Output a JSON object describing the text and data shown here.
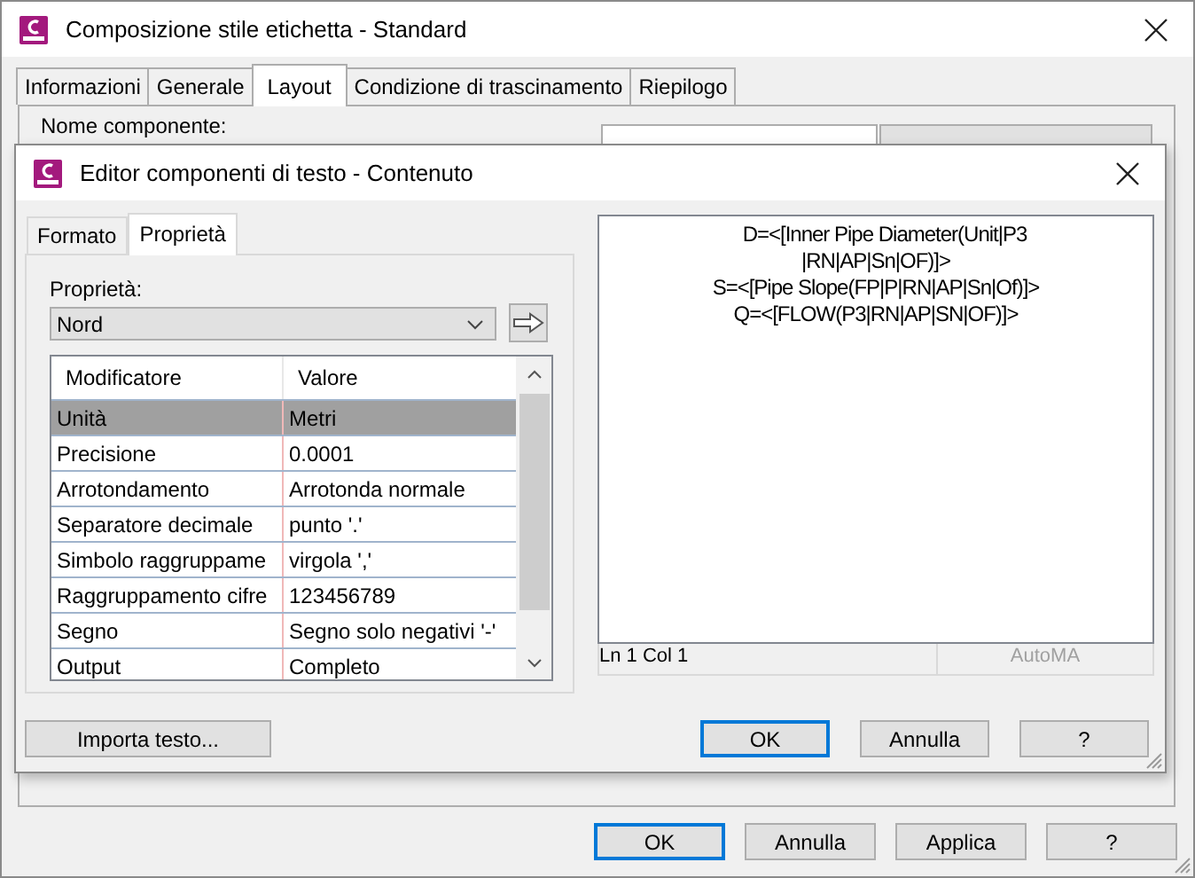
{
  "window": {
    "title": "Composizione stile etichetta - Standard"
  },
  "tabs": [
    {
      "label": "Informazioni",
      "selected": false
    },
    {
      "label": "Generale",
      "selected": false
    },
    {
      "label": "Layout",
      "selected": true
    },
    {
      "label": "Condizione di trascinamento",
      "selected": false
    },
    {
      "label": "Riepilogo",
      "selected": false
    }
  ],
  "layout_panel": {
    "component_name_label": "Nome componente:"
  },
  "text_editor": {
    "title": "Editor componenti di testo - Contenuto",
    "tabs": [
      {
        "label": "Formato",
        "selected": false
      },
      {
        "label": "Proprietà",
        "selected": true
      }
    ],
    "property_label": "Proprietà:",
    "property": "Nord",
    "table": {
      "columns": [
        "Modificatore",
        "Valore"
      ],
      "rows": [
        {
          "cells": [
            "Unità",
            "Metri"
          ],
          "selected": true
        },
        {
          "cells": [
            "Precisione",
            "0.0001"
          ],
          "selected": false
        },
        {
          "cells": [
            "Arrotondamento",
            "Arrotonda normale"
          ],
          "selected": false
        },
        {
          "cells": [
            "Separatore decimale",
            "punto '.'"
          ],
          "selected": false
        },
        {
          "cells": [
            "Simbolo raggruppame",
            "virgola ','"
          ],
          "selected": false
        },
        {
          "cells": [
            "Raggruppamento cifre",
            "123456789"
          ],
          "selected": false
        },
        {
          "cells": [
            "Segno",
            "Segno solo negativi '-'"
          ],
          "selected": false
        },
        {
          "cells": [
            "Output",
            "Completo"
          ],
          "selected": false
        }
      ]
    },
    "import_button": "Importa testo...",
    "content_lines": [
      "D=<[Inner Pipe Diameter(Unit|P3",
      "|RN|AP|Sn|OF)]>",
      "S=<[Pipe Slope(FP|P|RN|AP|Sn|Of)]>",
      "Q=<[FLOW(P3|RN|AP|SN|OF)]>"
    ],
    "status": {
      "position": "Ln 1 Col 1",
      "mode": {
        "label": "AutoMA",
        "disabled": true
      }
    },
    "buttons": [
      {
        "label": "OK",
        "default": true
      },
      {
        "label": "Annulla",
        "default": false
      },
      {
        "label": "?",
        "default": false
      }
    ]
  },
  "buttons": [
    {
      "label": "OK",
      "default": true
    },
    {
      "label": "Annulla",
      "default": false
    },
    {
      "label": "Applica",
      "default": false
    },
    {
      "label": "?",
      "default": false
    }
  ]
}
